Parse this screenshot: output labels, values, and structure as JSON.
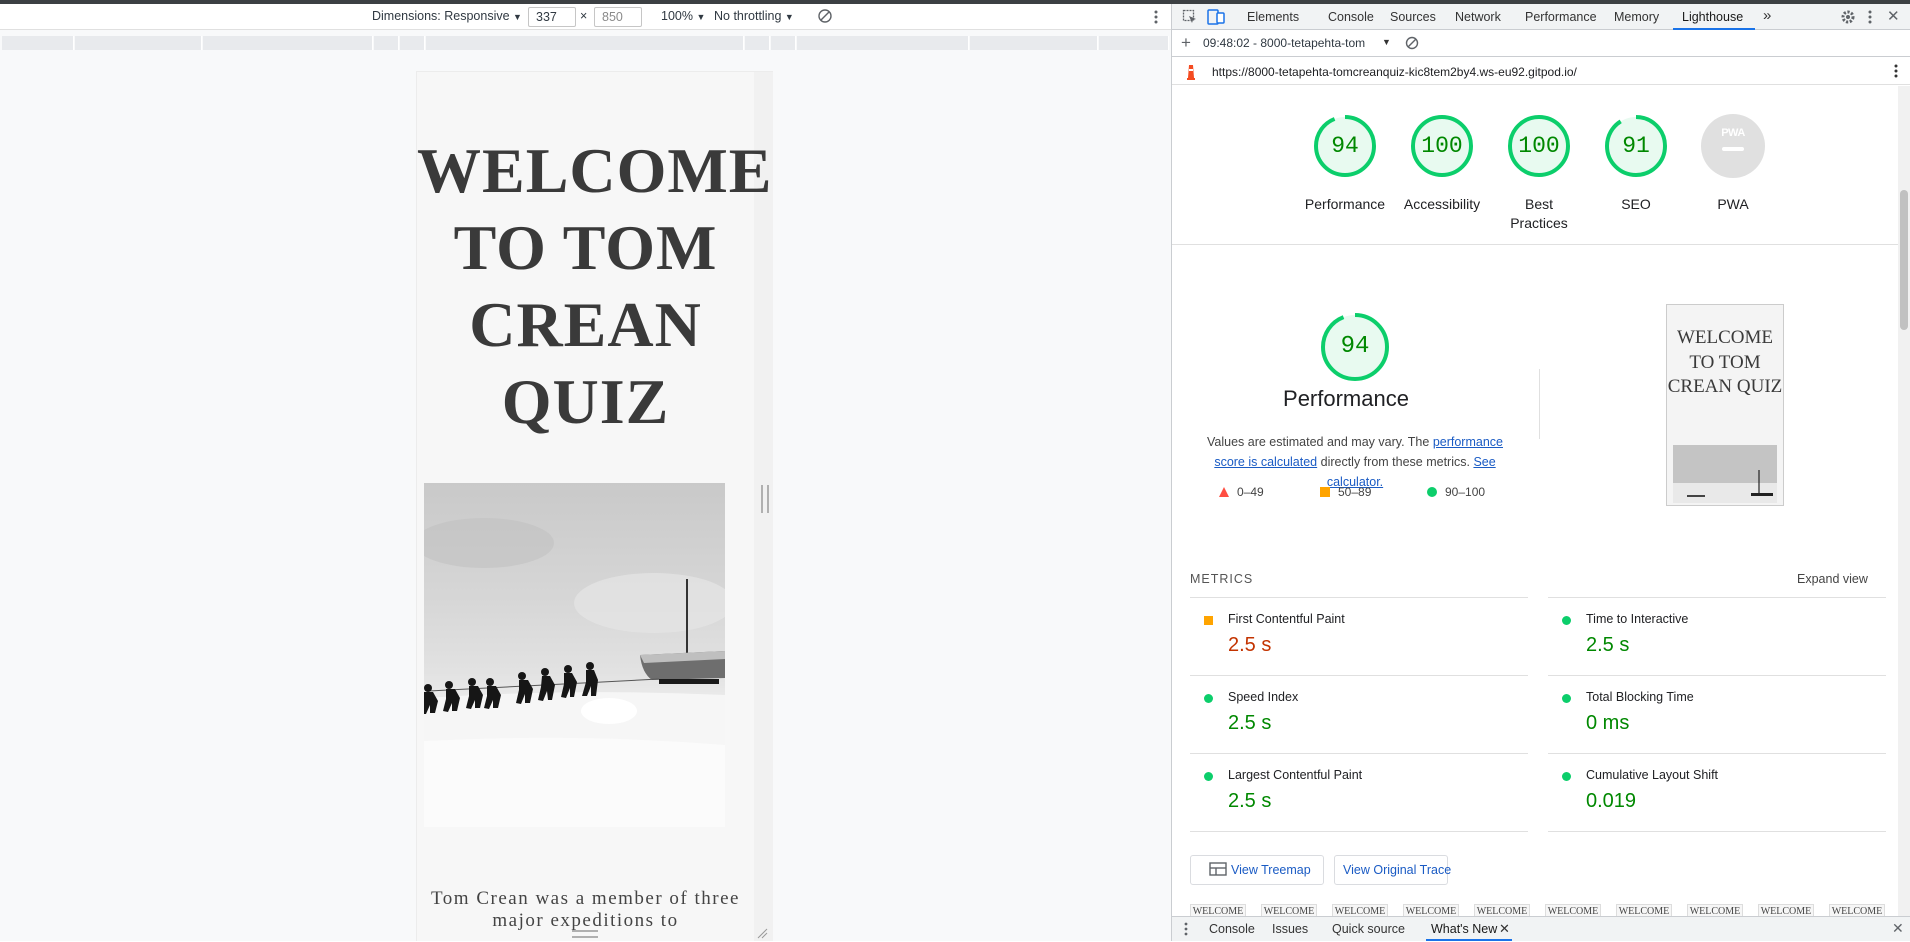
{
  "device_toolbar": {
    "dimensions_label": "Dimensions: Responsive",
    "width_value": "337",
    "height_value": "850",
    "times": "×",
    "zoom": "100%",
    "throttling": "No throttling"
  },
  "site": {
    "title": "WELCOME TO TOM CREAN QUIZ",
    "intro": "Tom Crean was a member of three major expeditions to"
  },
  "devtools": {
    "tabs": [
      "Elements",
      "Console",
      "Sources",
      "Network",
      "Performance",
      "Memory",
      "Lighthouse"
    ],
    "active_tab": "Lighthouse",
    "report_selector": "09:48:02 - 8000-tetapehta-tom",
    "url": "https://8000-tetapehta-tomcreanquiz-kic8tem2by4.ws-eu92.gitpod.io/",
    "drawer_tabs": [
      "Console",
      "Issues",
      "Quick source",
      "What's New"
    ],
    "active_drawer_tab": "What's New"
  },
  "scores": [
    {
      "label": "Performance",
      "score": 94
    },
    {
      "label": "Accessibility",
      "score": 100
    },
    {
      "label": "Best Practices",
      "score": 100
    },
    {
      "label": "SEO",
      "score": 91
    },
    {
      "label": "PWA",
      "score": null
    }
  ],
  "pwa_badge": "PWA",
  "performance": {
    "score": "94",
    "title": "Performance",
    "desc_before": "Values are estimated and may vary. The ",
    "desc_link1": "performance score is calculated",
    "desc_mid": " directly from these metrics. ",
    "desc_link2": "See calculator.",
    "legend": [
      "0–49",
      "50–89",
      "90–100"
    ],
    "thumbnail_title": "WELCOME TO TOM CREAN QUIZ"
  },
  "metrics": {
    "header": "METRICS",
    "expand": "Expand view",
    "items": [
      {
        "name": "First Contentful Paint",
        "value": "2.5 s",
        "status": "average"
      },
      {
        "name": "Time to Interactive",
        "value": "2.5 s",
        "status": "pass"
      },
      {
        "name": "Speed Index",
        "value": "2.5 s",
        "status": "pass"
      },
      {
        "name": "Total Blocking Time",
        "value": "0 ms",
        "status": "pass"
      },
      {
        "name": "Largest Contentful Paint",
        "value": "2.5 s",
        "status": "pass"
      },
      {
        "name": "Cumulative Layout Shift",
        "value": "0.019",
        "status": "pass"
      }
    ]
  },
  "buttons": {
    "treemap": "View Treemap",
    "trace": "View Original Trace"
  },
  "filmstrip_label": "WELCOME",
  "colors": {
    "pass": "#0cce6b",
    "pass_text": "#008800",
    "average": "#ffa400",
    "average_text": "#c33300",
    "fail": "#ff4e42",
    "accent": "#1a73e8"
  }
}
